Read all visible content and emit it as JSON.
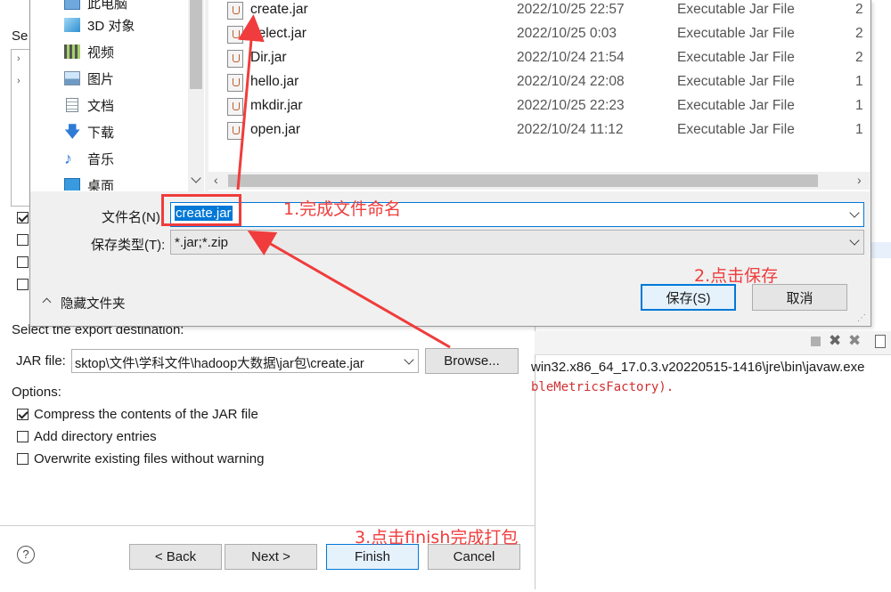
{
  "file_dialog": {
    "nav_items": [
      {
        "label": "此电脑",
        "icon": "computer-icon"
      },
      {
        "label": "3D 对象",
        "icon": "cube-3d-icon"
      },
      {
        "label": "视频",
        "icon": "video-icon"
      },
      {
        "label": "图片",
        "icon": "picture-icon"
      },
      {
        "label": "文档",
        "icon": "document-icon"
      },
      {
        "label": "下载",
        "icon": "download-arrow-icon"
      },
      {
        "label": "音乐",
        "icon": "music-note-icon"
      },
      {
        "label": "桌面",
        "icon": "desktop-icon"
      }
    ],
    "files": [
      {
        "name": "create.jar",
        "date": "2022/10/25 22:57",
        "type": "Executable Jar File",
        "size": "2"
      },
      {
        "name": "delect.jar",
        "date": "2022/10/25 0:03",
        "type": "Executable Jar File",
        "size": "2"
      },
      {
        "name": "Dir.jar",
        "date": "2022/10/24 21:54",
        "type": "Executable Jar File",
        "size": "2"
      },
      {
        "name": "hello.jar",
        "date": "2022/10/24 22:08",
        "type": "Executable Jar File",
        "size": "1"
      },
      {
        "name": "mkdir.jar",
        "date": "2022/10/25 22:23",
        "type": "Executable Jar File",
        "size": "1"
      },
      {
        "name": "open.jar",
        "date": "2022/10/24 11:12",
        "type": "Executable Jar File",
        "size": "1"
      }
    ],
    "filename_label": "文件名(N):",
    "filename_value": "create.jar",
    "filetype_label": "保存类型(T):",
    "filetype_value": "*.jar;*.zip",
    "hide_folders_label": "隐藏文件夹",
    "save_label": "保存(S)",
    "cancel_label": "取消"
  },
  "export_wizard": {
    "partial_label": "Se",
    "destination_heading": "Select the export destination:",
    "jar_file_label": "JAR file:",
    "jar_file_value": "sktop\\文件\\学科文件\\hadoop大数据\\jar包\\create.jar",
    "browse_label": "Browse...",
    "options_heading": "Options:",
    "options": [
      {
        "label": "Compress the contents of the JAR file",
        "checked": true
      },
      {
        "label": "Add directory entries",
        "checked": false
      },
      {
        "label": "Overwrite existing files without warning",
        "checked": false
      }
    ],
    "help_symbol": "?",
    "back_label": "< Back",
    "next_label": "Next >",
    "finish_label": "Finish",
    "cancel_label": "Cancel"
  },
  "console": {
    "path_text": "win32.x86_64_17.0.3.v20220515-1416\\jre\\bin\\javaw.exe",
    "error_text": "bleMetricsFactory)."
  },
  "annotations": {
    "step1": "1.完成文件命名",
    "step2": "2.点击保存",
    "step3": "3.点击finish完成打包",
    "color": "#f03c3c"
  }
}
